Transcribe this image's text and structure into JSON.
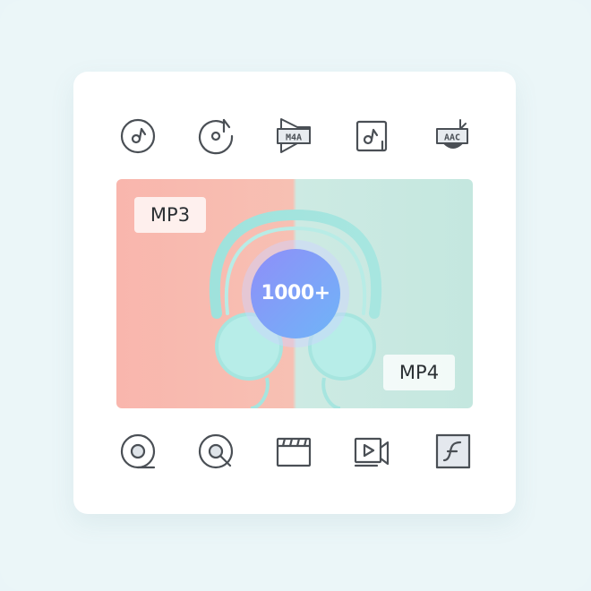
{
  "colors": {
    "page_bg": "#eaf5f8",
    "card_bg": "#ffffff",
    "icon_stroke": "#4a4f55",
    "banner_left": "#f9b6ad",
    "banner_right": "#c4e7df",
    "badge_gradient_start": "#8f8ef9",
    "badge_gradient_end": "#6fb5f7"
  },
  "top_icons": [
    {
      "name": "music-disc-icon"
    },
    {
      "name": "music-disc-note-icon"
    },
    {
      "name": "m4a-file-icon",
      "text": "M4A"
    },
    {
      "name": "music-note-square-icon"
    },
    {
      "name": "aac-file-icon",
      "text": "AAC"
    }
  ],
  "bottom_icons": [
    {
      "name": "disc-icon"
    },
    {
      "name": "disc-search-icon"
    },
    {
      "name": "clapperboard-icon"
    },
    {
      "name": "video-camera-icon"
    },
    {
      "name": "flash-icon"
    }
  ],
  "banner": {
    "left_label": "MP3",
    "right_label": "MP4",
    "badge_text": "1000+"
  }
}
